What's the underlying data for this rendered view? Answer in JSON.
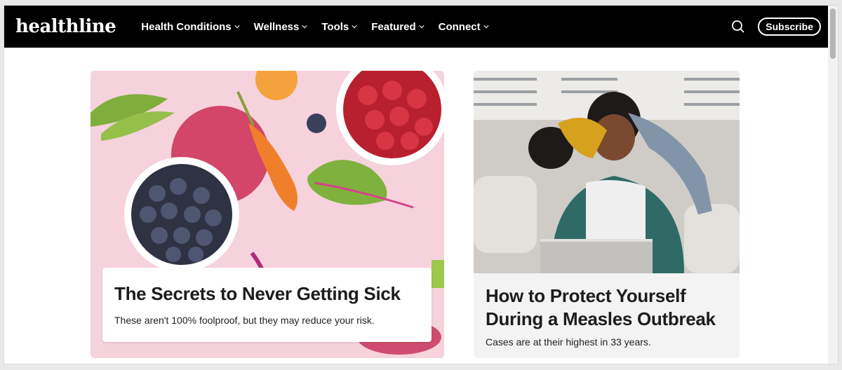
{
  "header": {
    "logo": "healthline",
    "nav": [
      {
        "label": "Health Conditions"
      },
      {
        "label": "Wellness"
      },
      {
        "label": "Tools"
      },
      {
        "label": "Featured"
      },
      {
        "label": "Connect"
      }
    ],
    "subscribe_label": "Subscribe",
    "icons": {
      "search": "search-icon",
      "chevron": "chevron-down-icon"
    }
  },
  "cards": [
    {
      "title": "The Secrets to Never Getting Sick",
      "subtitle": "These aren't 100% foolproof, but they may reduce your risk."
    },
    {
      "title": "How to Protect Yourself During a Measles Outbreak",
      "subtitle": "Cases are at their highest in 33 years."
    }
  ],
  "colors": {
    "header_bg": "#000000",
    "card1_bg": "#f6d2dd",
    "text": "#1c1c1c"
  }
}
